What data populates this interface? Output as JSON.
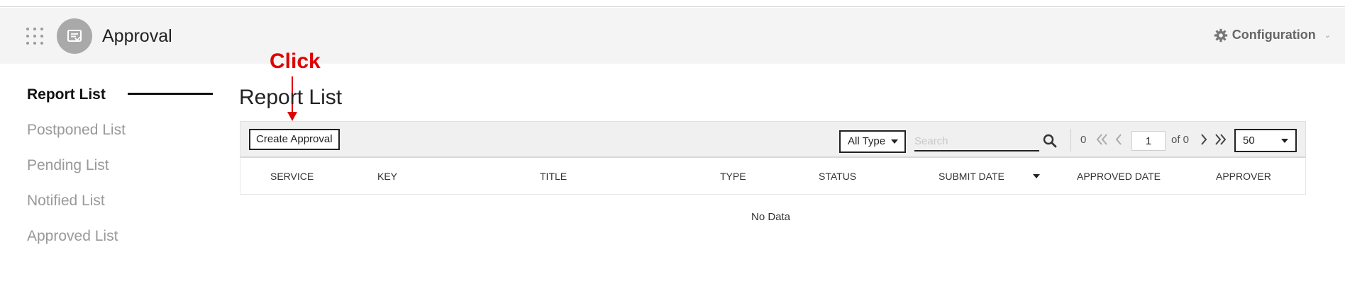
{
  "header": {
    "app_title": "Approval",
    "config_label": "Configuration",
    "icons": {
      "apps": "apps-grid-icon",
      "logo": "approval-doc-icon",
      "config": "gear-icon"
    }
  },
  "sidebar": {
    "items": [
      {
        "label": "Report List",
        "active": true
      },
      {
        "label": "Postponed List",
        "active": false
      },
      {
        "label": "Pending List",
        "active": false
      },
      {
        "label": "Notified List",
        "active": false
      },
      {
        "label": "Approved List",
        "active": false
      }
    ]
  },
  "annotation": {
    "text": "Click",
    "color": "#e00000"
  },
  "main": {
    "title": "Report List",
    "toolbar": {
      "create_label": "Create Approval",
      "type_filter": "All Type",
      "search_placeholder": "Search",
      "count": "0",
      "page": "1",
      "of_pages": "of 0",
      "page_size": "50"
    },
    "table": {
      "columns": [
        "SERVICE",
        "KEY",
        "TITLE",
        "TYPE",
        "STATUS",
        "SUBMIT DATE",
        "APPROVED DATE",
        "APPROVER"
      ],
      "sorted_column": "SUBMIT DATE",
      "empty_text": "No Data"
    }
  }
}
